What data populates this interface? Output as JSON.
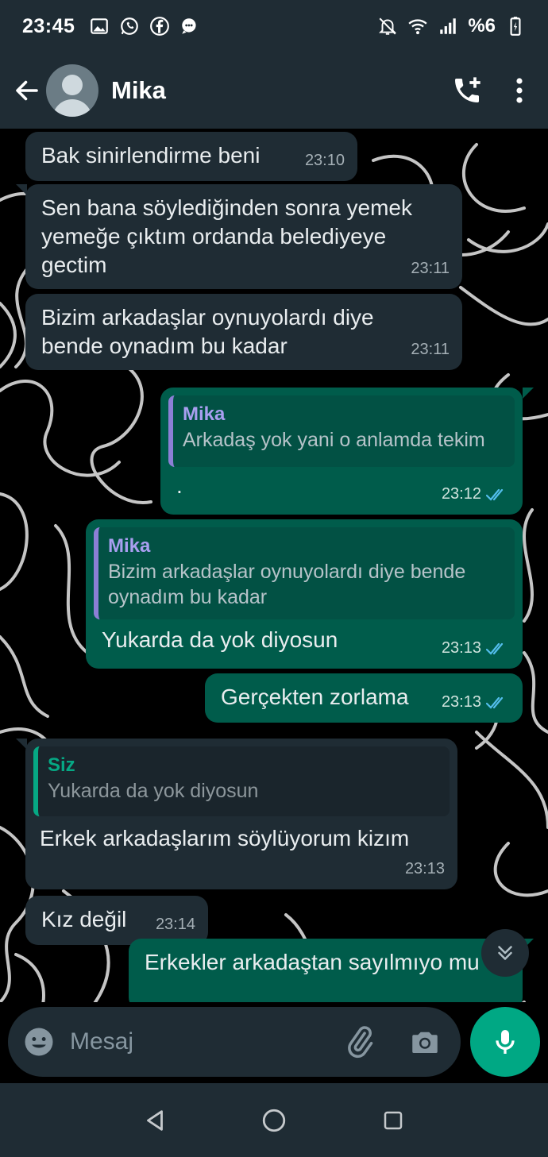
{
  "status_bar": {
    "time": "23:45",
    "battery_text": "%6",
    "icons_left": [
      "gallery-icon",
      "whatsapp-icon",
      "facebook-icon",
      "chat-bubble-icon"
    ],
    "icons_right": [
      "mute-bell-icon",
      "wifi-icon",
      "signal-icon",
      "battery-charging-icon"
    ]
  },
  "header": {
    "contact_name": "Mika",
    "actions": [
      "add-call-icon",
      "more-options-icon"
    ]
  },
  "messages": [
    {
      "dir": "in",
      "text": "Bak sinirlendirme beni",
      "time": "23:10"
    },
    {
      "dir": "in",
      "text": "Sen bana söylediğinden sonra yemek yemeğe çıktım ordanda belediyeye gectim",
      "time": "23:11"
    },
    {
      "dir": "in",
      "text": "Bizim arkadaşlar oynuyolardı diye bende oynadım bu kadar",
      "time": "23:11"
    },
    {
      "dir": "out",
      "quote_author": "Mika",
      "quote_text": "Arkadaş yok yani o anlamda tekim",
      "text": ".",
      "time": "23:12"
    },
    {
      "dir": "out",
      "quote_author": "Mika",
      "quote_text": "Bizim arkadaşlar oynuyolardı diye bende oynadım bu kadar",
      "text": "Yukarda da yok diyosun",
      "time": "23:13"
    },
    {
      "dir": "out",
      "text": "Gerçekten zorlama",
      "time": "23:13"
    },
    {
      "dir": "in",
      "quote_author": "Siz",
      "quote_text": "Yukarda da yok diyosun",
      "text": "Erkek arkadaşlarım söylüyorum kizım",
      "time": "23:13"
    },
    {
      "dir": "in",
      "text": "Kız değil",
      "time": "23:14"
    },
    {
      "dir": "out",
      "text": "Erkekler arkadaştan sayılmıyo mu",
      "time": ""
    }
  ],
  "input": {
    "placeholder": "Mesaj"
  },
  "colors": {
    "bar_bg": "#1f2c34",
    "incoming_bubble": "#1f2c34",
    "outgoing_bubble": "#005c4b",
    "accent_green": "#00a884",
    "read_ticks": "#53bdeb"
  }
}
